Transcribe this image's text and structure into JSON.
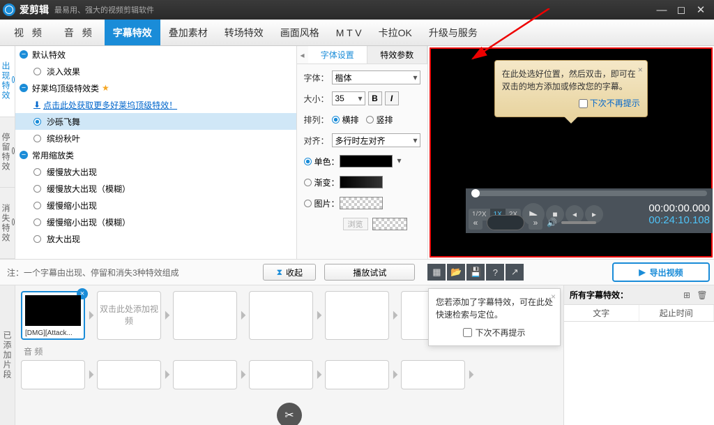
{
  "app": {
    "title": "爱剪辑",
    "subtitle": "最易用、强大的视频剪辑软件"
  },
  "tabs": [
    "视 频",
    "音 频",
    "字幕特效",
    "叠加素材",
    "转场特效",
    "画面风格",
    "M T V",
    "卡拉OK",
    "升级与服务"
  ],
  "active_tab": 2,
  "side_cats": [
    "出现特效",
    "停留特效",
    "消失特效"
  ],
  "fx": {
    "g1": "默认特效",
    "g1i1": "淡入效果",
    "g2": "好莱坞顶级特效类",
    "g2link": "点击此处获取更多好莱坞顶级特效！",
    "g2i1": "沙砾飞舞",
    "g2i2": "缤纷秋叶",
    "g3": "常用缩放类",
    "g3i1": "缓慢放大出现",
    "g3i2": "缓慢放大出现（模糊）",
    "g3i3": "缓慢缩小出现",
    "g3i4": "缓慢缩小出现（模糊）",
    "g3i5": "放大出现"
  },
  "mid_tabs": [
    "字体设置",
    "特效参数"
  ],
  "props": {
    "font_lbl": "字体：",
    "font_val": "楷体",
    "size_lbl": "大小：",
    "size_val": "35",
    "arr_lbl": "排列：",
    "arr_h": "横排",
    "arr_v": "竖排",
    "align_lbl": "对齐：",
    "align_val": "多行时左对齐",
    "solid": "单色：",
    "grad": "渐变：",
    "pic": "图片：",
    "browse": "浏览"
  },
  "preview_tip": {
    "text": "在此处选好位置，然后双击，即可在双击的地方添加或修改您的字幕。",
    "chk": "下次不再提示"
  },
  "note": "注：一个字幕由出现、停留和消失3种特效组成",
  "collapse": "收起",
  "playtest": "播放试试",
  "export": "导出视频",
  "speeds": [
    "1/2X",
    "1X",
    "2X"
  ],
  "time": {
    "cur": "00:00:00.000",
    "dur": "00:24:10.108"
  },
  "clip": {
    "name": "[DMG][Attack...",
    "add": "双击此处添加视频",
    "audio": "音 频"
  },
  "tip2": {
    "text": "您若添加了字幕特效，可在此处快速检索与定位。",
    "chk": "下次不再提示"
  },
  "rpanel": {
    "title": "所有字幕特效：",
    "c1": "文字",
    "c2": "起止时间"
  },
  "added": "已添加片段"
}
